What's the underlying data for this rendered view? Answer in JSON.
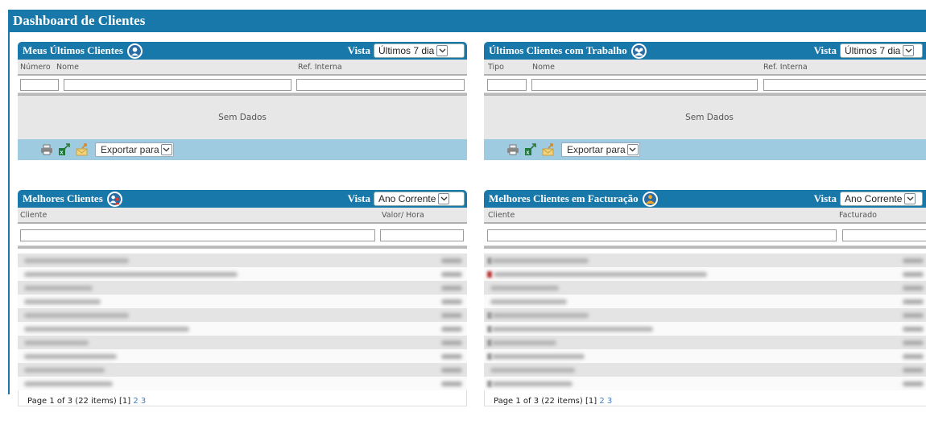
{
  "dashboard": {
    "title": "Dashboard de Clientes"
  },
  "panels": {
    "meus_ultimos": {
      "title": "Meus Últimos Clientes",
      "vista_label": "Vista",
      "vista_value": "Últimos 7 dia",
      "columns": [
        "Número",
        "Nome",
        "Ref. Interna"
      ],
      "no_data": "Sem Dados",
      "export_label": "Exportar para"
    },
    "ultimos_trabalho": {
      "title": "Últimos Clientes com Trabalho",
      "vista_label": "Vista",
      "vista_value": "Últimos 7 dia",
      "columns": [
        "Tipo",
        "Nome",
        "Ref. Interna"
      ],
      "no_data": "Sem Dados",
      "export_label": "Exportar para"
    },
    "melhores": {
      "title": "Melhores Clientes",
      "vista_label": "Vista",
      "vista_value": "Ano Corrente",
      "columns": [
        "Cliente",
        "Valor/ Hora"
      ],
      "pager_text": "Page 1 of 3 (22 items)",
      "pager_current": "[1]",
      "pager_links": [
        "2",
        "3"
      ]
    },
    "melhores_facturacao": {
      "title": "Melhores Clientes em Facturação",
      "vista_label": "Vista",
      "vista_value": "Ano Corrente",
      "columns": [
        "Cliente",
        "Facturado"
      ],
      "pager_text": "Page 1 of 3 (22 items)",
      "pager_current": "[1]",
      "pager_links": [
        "2",
        "3"
      ]
    }
  },
  "icons": {
    "single_user": "person-icon",
    "group": "group-icon",
    "best_clients": "people-red-icon",
    "billing": "people-orange-icon",
    "print": "print-icon",
    "excel": "excel-export-icon",
    "email": "email-export-icon",
    "dropdown": "chevron-down-icon"
  },
  "colors": {
    "header_blue": "#1778a9",
    "toolbar_blue": "#9fcbe0"
  }
}
